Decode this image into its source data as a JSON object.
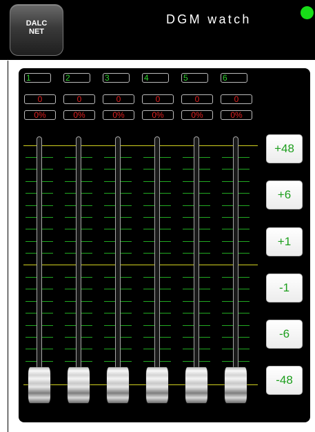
{
  "header": {
    "logo_line1": "DALC",
    "logo_line2": "NET",
    "title": "DGM watch",
    "status_color": "#18dd18"
  },
  "channels": [
    {
      "number": "1",
      "value": "0",
      "percent": "0%",
      "level": 0
    },
    {
      "number": "2",
      "value": "0",
      "percent": "0%",
      "level": 0
    },
    {
      "number": "3",
      "value": "0",
      "percent": "0%",
      "level": 0
    },
    {
      "number": "4",
      "value": "0",
      "percent": "0%",
      "level": 0
    },
    {
      "number": "5",
      "value": "0",
      "percent": "0%",
      "level": 0
    },
    {
      "number": "6",
      "value": "0",
      "percent": "0%",
      "level": 0
    }
  ],
  "step_buttons": [
    {
      "label": "+48",
      "id": "plus-48"
    },
    {
      "label": "+6",
      "id": "plus-6"
    },
    {
      "label": "+1",
      "id": "plus-1"
    },
    {
      "label": "-1",
      "id": "minus-1"
    },
    {
      "label": "-6",
      "id": "minus-6"
    },
    {
      "label": "-48",
      "id": "minus-48"
    }
  ],
  "colors": {
    "channel_number": "#30d030",
    "channel_value": "#e02020",
    "scale_major": "#d4d420",
    "scale_minor": "#22aa22",
    "button_text": "#1c9e1c"
  }
}
